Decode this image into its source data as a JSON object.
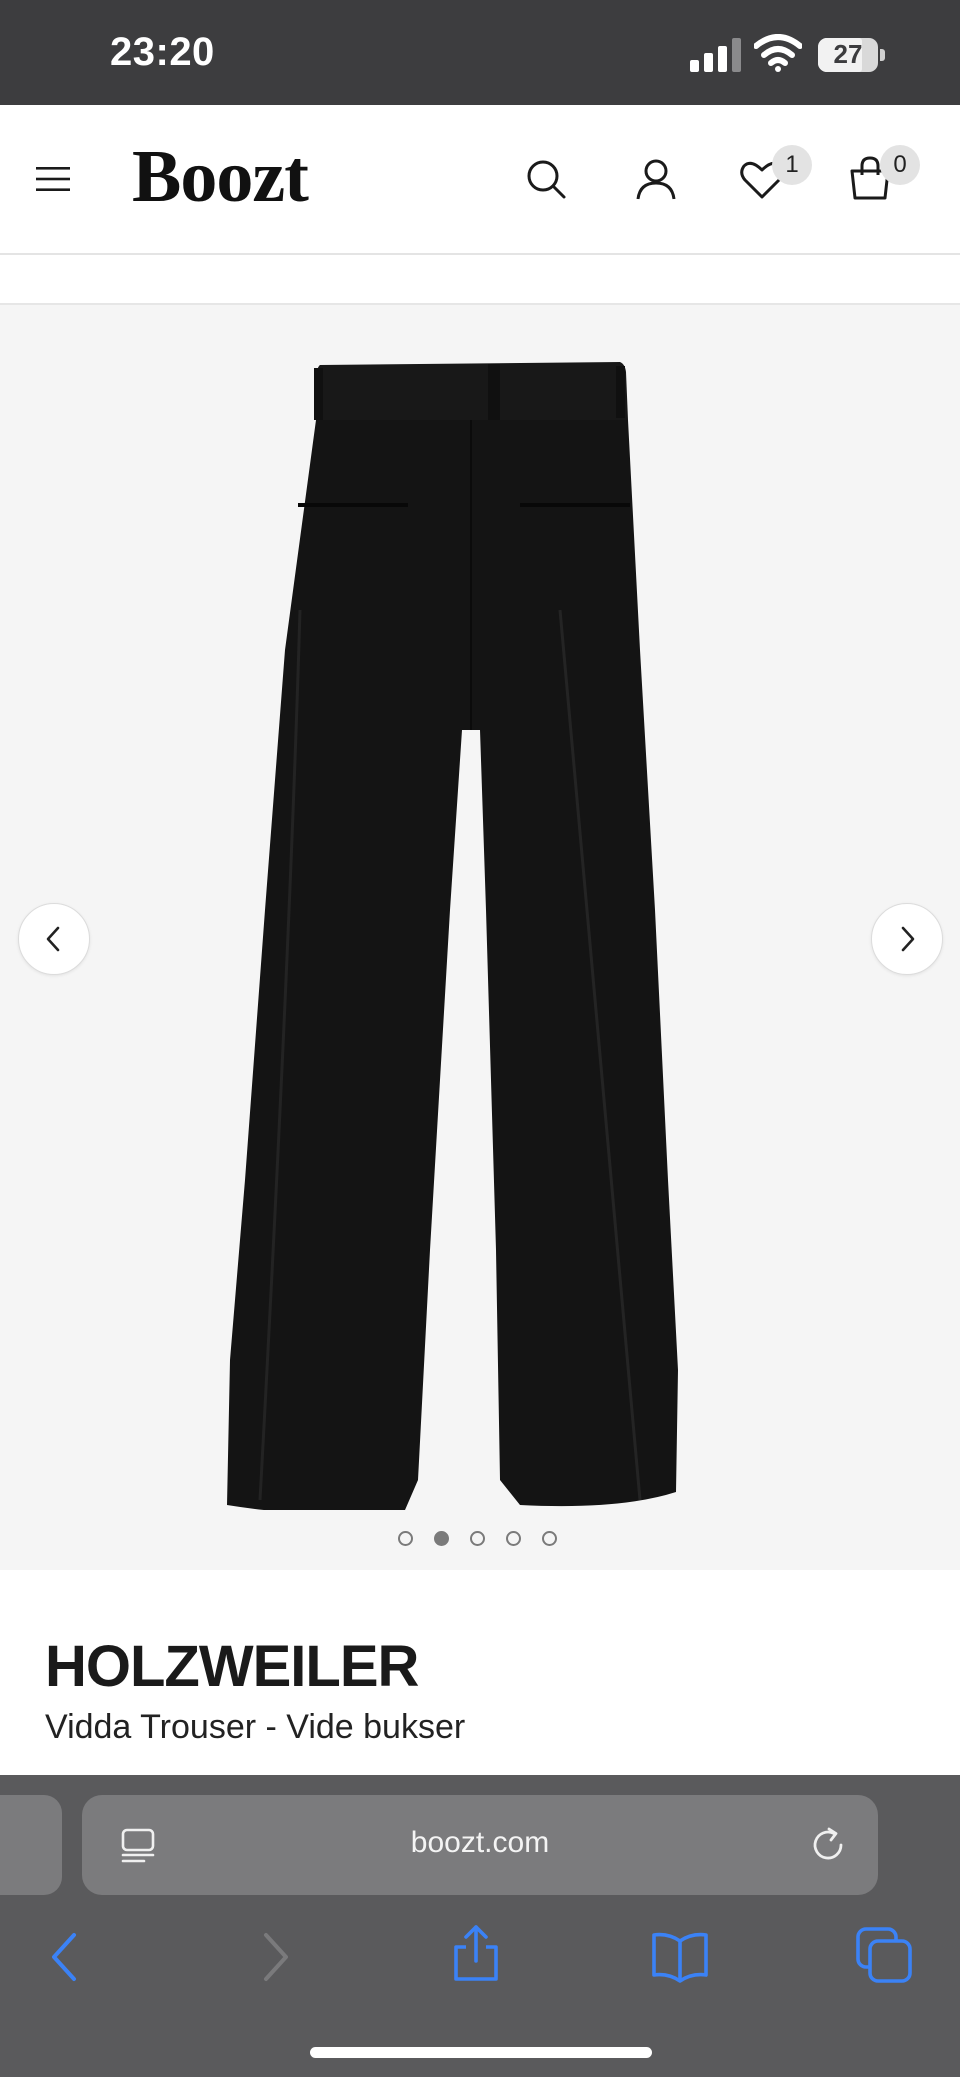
{
  "status_bar": {
    "time": "23:20",
    "battery_level": "27",
    "icons": [
      "signal-icon",
      "wifi-icon",
      "battery-icon"
    ]
  },
  "header": {
    "logo": "Boozt",
    "wishlist_count": "1",
    "cart_count": "0",
    "icons": [
      "menu-icon",
      "search-icon",
      "user-icon",
      "heart-icon",
      "bag-icon"
    ]
  },
  "gallery": {
    "image_count": 5,
    "active_index": 1,
    "icons": [
      "chevron-left-icon",
      "chevron-right-icon"
    ]
  },
  "product": {
    "brand": "HOLZWEILER",
    "name": "Vidda Trouser - Vide bukser"
  },
  "browser": {
    "url": "boozt.com",
    "icons": [
      "reader-icon",
      "reload-icon",
      "back-icon",
      "forward-icon",
      "share-icon",
      "book-icon",
      "tabs-icon"
    ]
  },
  "colors": {
    "status_bar": "#3d3d3f",
    "gallery_bg": "#f5f5f5",
    "safari_bar": "#5a5a5c",
    "toolbar_accent": "#3b82f6"
  }
}
